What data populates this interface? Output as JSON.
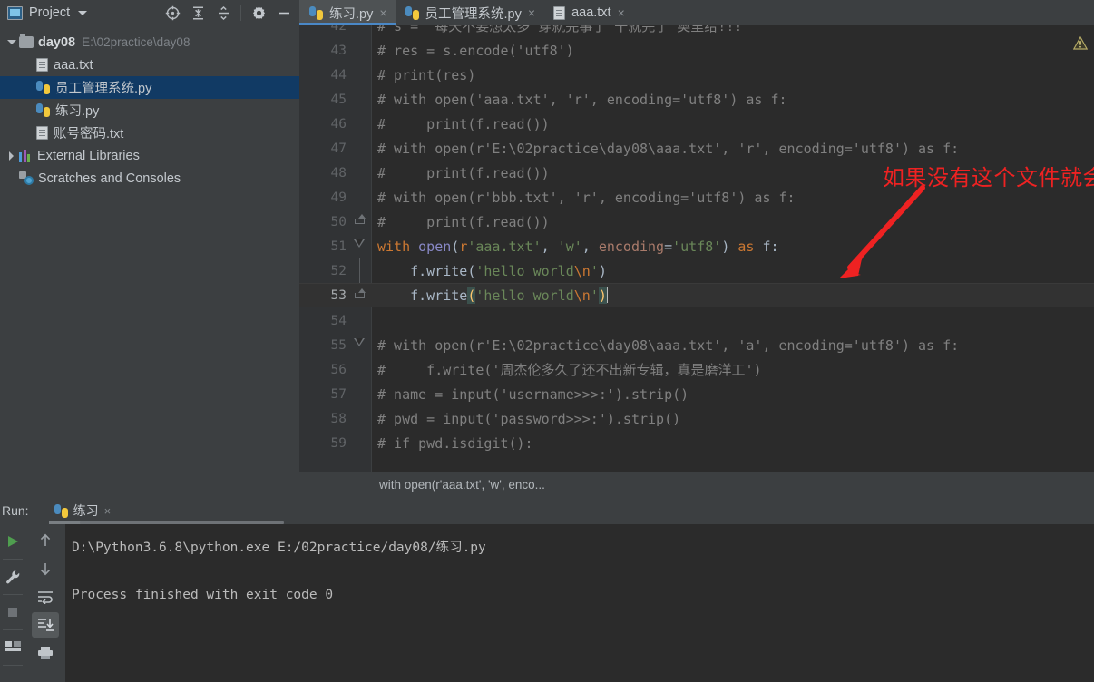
{
  "project_panel": {
    "title": "Project",
    "icons": [
      "project-icon",
      "chevron-down-icon",
      "locate-icon",
      "expand-all-icon",
      "collapse-all-icon",
      "settings-gear-icon",
      "minimize-icon"
    ],
    "tree": [
      {
        "label": "day08",
        "path": "E:\\02practice\\day08",
        "icon": "folder-icon",
        "indent": 0,
        "selected": false,
        "expanded": true,
        "bold": true
      },
      {
        "label": "aaa.txt",
        "path": "",
        "icon": "text-file-icon",
        "indent": 1,
        "selected": false
      },
      {
        "label": "员工管理系统.py",
        "path": "",
        "icon": "python-file-icon",
        "indent": 1,
        "selected": true
      },
      {
        "label": "练习.py",
        "path": "",
        "icon": "python-file-icon",
        "indent": 1,
        "selected": false
      },
      {
        "label": "账号密码.txt",
        "path": "",
        "icon": "text-file-icon",
        "indent": 1,
        "selected": false
      },
      {
        "label": "External Libraries",
        "path": "",
        "icon": "library-icon",
        "indent": 0,
        "selected": false,
        "expanded": false
      },
      {
        "label": "Scratches and Consoles",
        "path": "",
        "icon": "scratches-icon",
        "indent": 0,
        "selected": false
      }
    ]
  },
  "tabs": [
    {
      "label": "练习.py",
      "icon": "python-file-icon",
      "active": true,
      "close": "×"
    },
    {
      "label": "员工管理系统.py",
      "icon": "python-file-icon",
      "active": false,
      "close": "×"
    },
    {
      "label": "aaa.txt",
      "icon": "text-file-icon",
      "active": false,
      "close": "×"
    }
  ],
  "editor": {
    "first_line": 42,
    "current_line": 53,
    "lines": [
      {
        "n": 42,
        "text": "# s = '每天不要想太多 穿就完事了 干就完了 奥里给!!!'"
      },
      {
        "n": 43,
        "text": "# res = s.encode('utf8')"
      },
      {
        "n": 44,
        "text": "# print(res)"
      },
      {
        "n": 45,
        "text": "# with open('aaa.txt', 'r', encoding='utf8') as f:"
      },
      {
        "n": 46,
        "text": "#     print(f.read())"
      },
      {
        "n": 47,
        "text": "# with open(r'E:\\02practice\\day08\\aaa.txt', 'r', encoding='utf8') as f:"
      },
      {
        "n": 48,
        "text": "#     print(f.read())"
      },
      {
        "n": 49,
        "text": "# with open(r'bbb.txt', 'r', encoding='utf8') as f:"
      },
      {
        "n": 50,
        "text": "#     print(f.read())"
      },
      {
        "n": 51,
        "text": "with open(r'aaa.txt', 'w', encoding='utf8') as f:"
      },
      {
        "n": 52,
        "text": "    f.write('hello world\\n')"
      },
      {
        "n": 53,
        "text": "    f.write('hello world\\n')"
      },
      {
        "n": 54,
        "text": ""
      },
      {
        "n": 55,
        "text": "# with open(r'E:\\02practice\\day08\\aaa.txt', 'a', encoding='utf8') as f:"
      },
      {
        "n": 56,
        "text": "#     f.write('周杰伦多久了还不出新专辑，真是磨洋工')"
      },
      {
        "n": 57,
        "text": "# name = input('username>>>:').strip()"
      },
      {
        "n": 58,
        "text": "# pwd = input('password>>>:').strip()"
      },
      {
        "n": 59,
        "text": "# if pwd.isdigit():"
      }
    ],
    "annotation": {
      "text": "如果没有这个文件就会新建这个文件",
      "color": "#ee2222",
      "arrow": "red-arrow-annotation"
    },
    "warning_icon": "warning-triangle-icon",
    "breadcrumb": "with open(r'aaa.txt', 'w', enco..."
  },
  "run_panel": {
    "label": "Run:",
    "tab_label": "练习",
    "tab_icon": "python-file-icon",
    "tab_close": "×",
    "left_rail_icons": [
      "run-icon",
      "wrench-icon",
      "stop-icon",
      "layout-icon"
    ],
    "console_rail_icons": [
      "arrow-up-icon",
      "arrow-down-icon",
      "soft-wrap-icon",
      "scroll-to-end-icon",
      "print-icon"
    ],
    "console_lines": [
      "D:\\Python3.6.8\\python.exe E:/02practice/day08/练习.py",
      "",
      "Process finished with exit code 0"
    ]
  },
  "colors": {
    "chrome": "#3c3f41",
    "editor_bg": "#2b2b2b",
    "gutter_bg": "#313335",
    "selection_blue": "#113a64",
    "tab_underline": "#4a88c7",
    "keyword": "#cc7832",
    "string": "#6a8759",
    "function": "#8888c6",
    "comment": "#808080",
    "text": "#a9b7c6",
    "annotation_red": "#ee2222"
  }
}
